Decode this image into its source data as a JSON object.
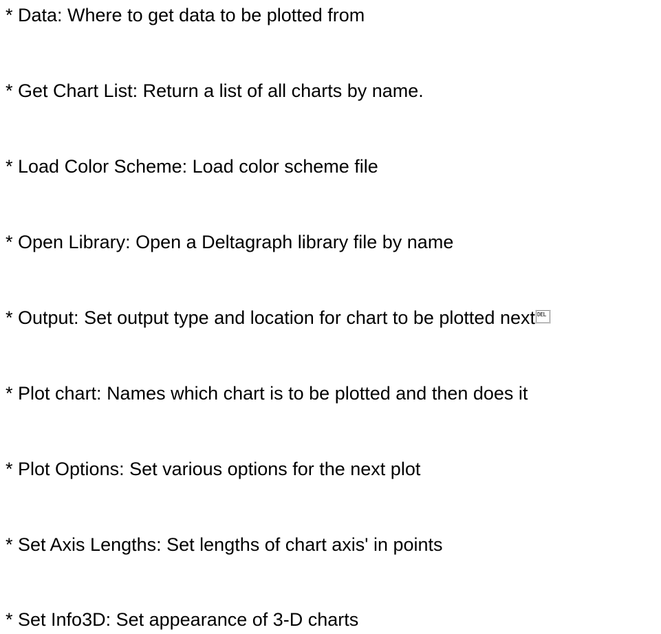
{
  "document": {
    "lines": [
      "* Data: Where to get data to be plotted from",
      "* Get Chart List: Return a list of all charts by name.",
      "* Load Color Scheme: Load color scheme file",
      "* Open Library: Open a Deltagraph library file by name",
      "* Output: Set output type and location for chart to be plotted next",
      "* Plot chart: Names which chart is to be plotted and then does it",
      "* Plot Options: Set various options for the next plot",
      "* Set Axis Lengths: Set lengths of chart axis' in points",
      "* Set Info3D: Set appearance of 3-D charts"
    ],
    "control_glyph": "DEL"
  }
}
